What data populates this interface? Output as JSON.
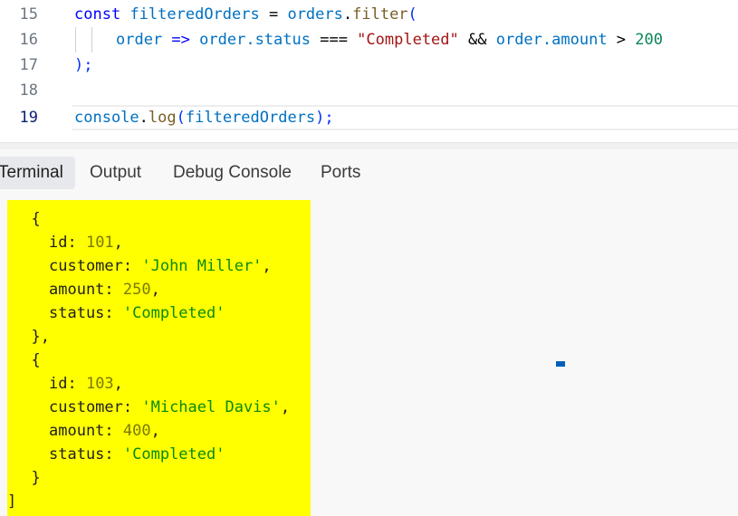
{
  "editor": {
    "lines": [
      {
        "num": "15"
      },
      {
        "num": "16"
      },
      {
        "num": "17"
      },
      {
        "num": "18"
      },
      {
        "num": "19"
      }
    ],
    "tokens": {
      "l15_const": "const",
      "l15_name": "filteredOrders",
      "l15_eq": " = ",
      "l15_orders": "orders",
      "l15_dot": ".",
      "l15_filter": "filter",
      "l15_paren": "(",
      "l16_order": "order",
      "l16_arrow": " => ",
      "l16_order2": "order",
      "l16_status": ".status",
      "l16_eqeq": " === ",
      "l16_str": "\"Completed\"",
      "l16_and": " && ",
      "l16_order3": "order",
      "l16_amount": ".amount",
      "l16_gt": " > ",
      "l16_num": "200",
      "l17_close": ");",
      "l19_console": "console",
      "l19_dot": ".",
      "l19_log": "log",
      "l19_open": "(",
      "l19_arg": "filteredOrders",
      "l19_close": ");"
    }
  },
  "panel": {
    "tabs": [
      {
        "label": "Terminal",
        "active": true
      },
      {
        "label": "Output"
      },
      {
        "label": "Debug Console"
      },
      {
        "label": "Ports"
      }
    ]
  },
  "terminal": {
    "open_brace_1": "  {",
    "id_key": "id: ",
    "id_1": "101",
    "customer_key": "customer: ",
    "customer_1": "'John Miller'",
    "amount_key": "amount: ",
    "amount_1": "250",
    "status_key": "status: ",
    "status_1": "'Completed'",
    "close_brace_1": "  },",
    "open_brace_2": "  {",
    "id_2": "103",
    "customer_2": "'Michael Davis'",
    "amount_2": "400",
    "status_2": "'Completed'",
    "close_brace_2": "  }",
    "close_bracket": "]",
    "comma": ","
  },
  "colors": {
    "highlight": "#ffff00",
    "keyword": "#0000ff",
    "variable": "#0070c1",
    "function": "#795e26",
    "string": "#a31515",
    "number": "#098658"
  }
}
